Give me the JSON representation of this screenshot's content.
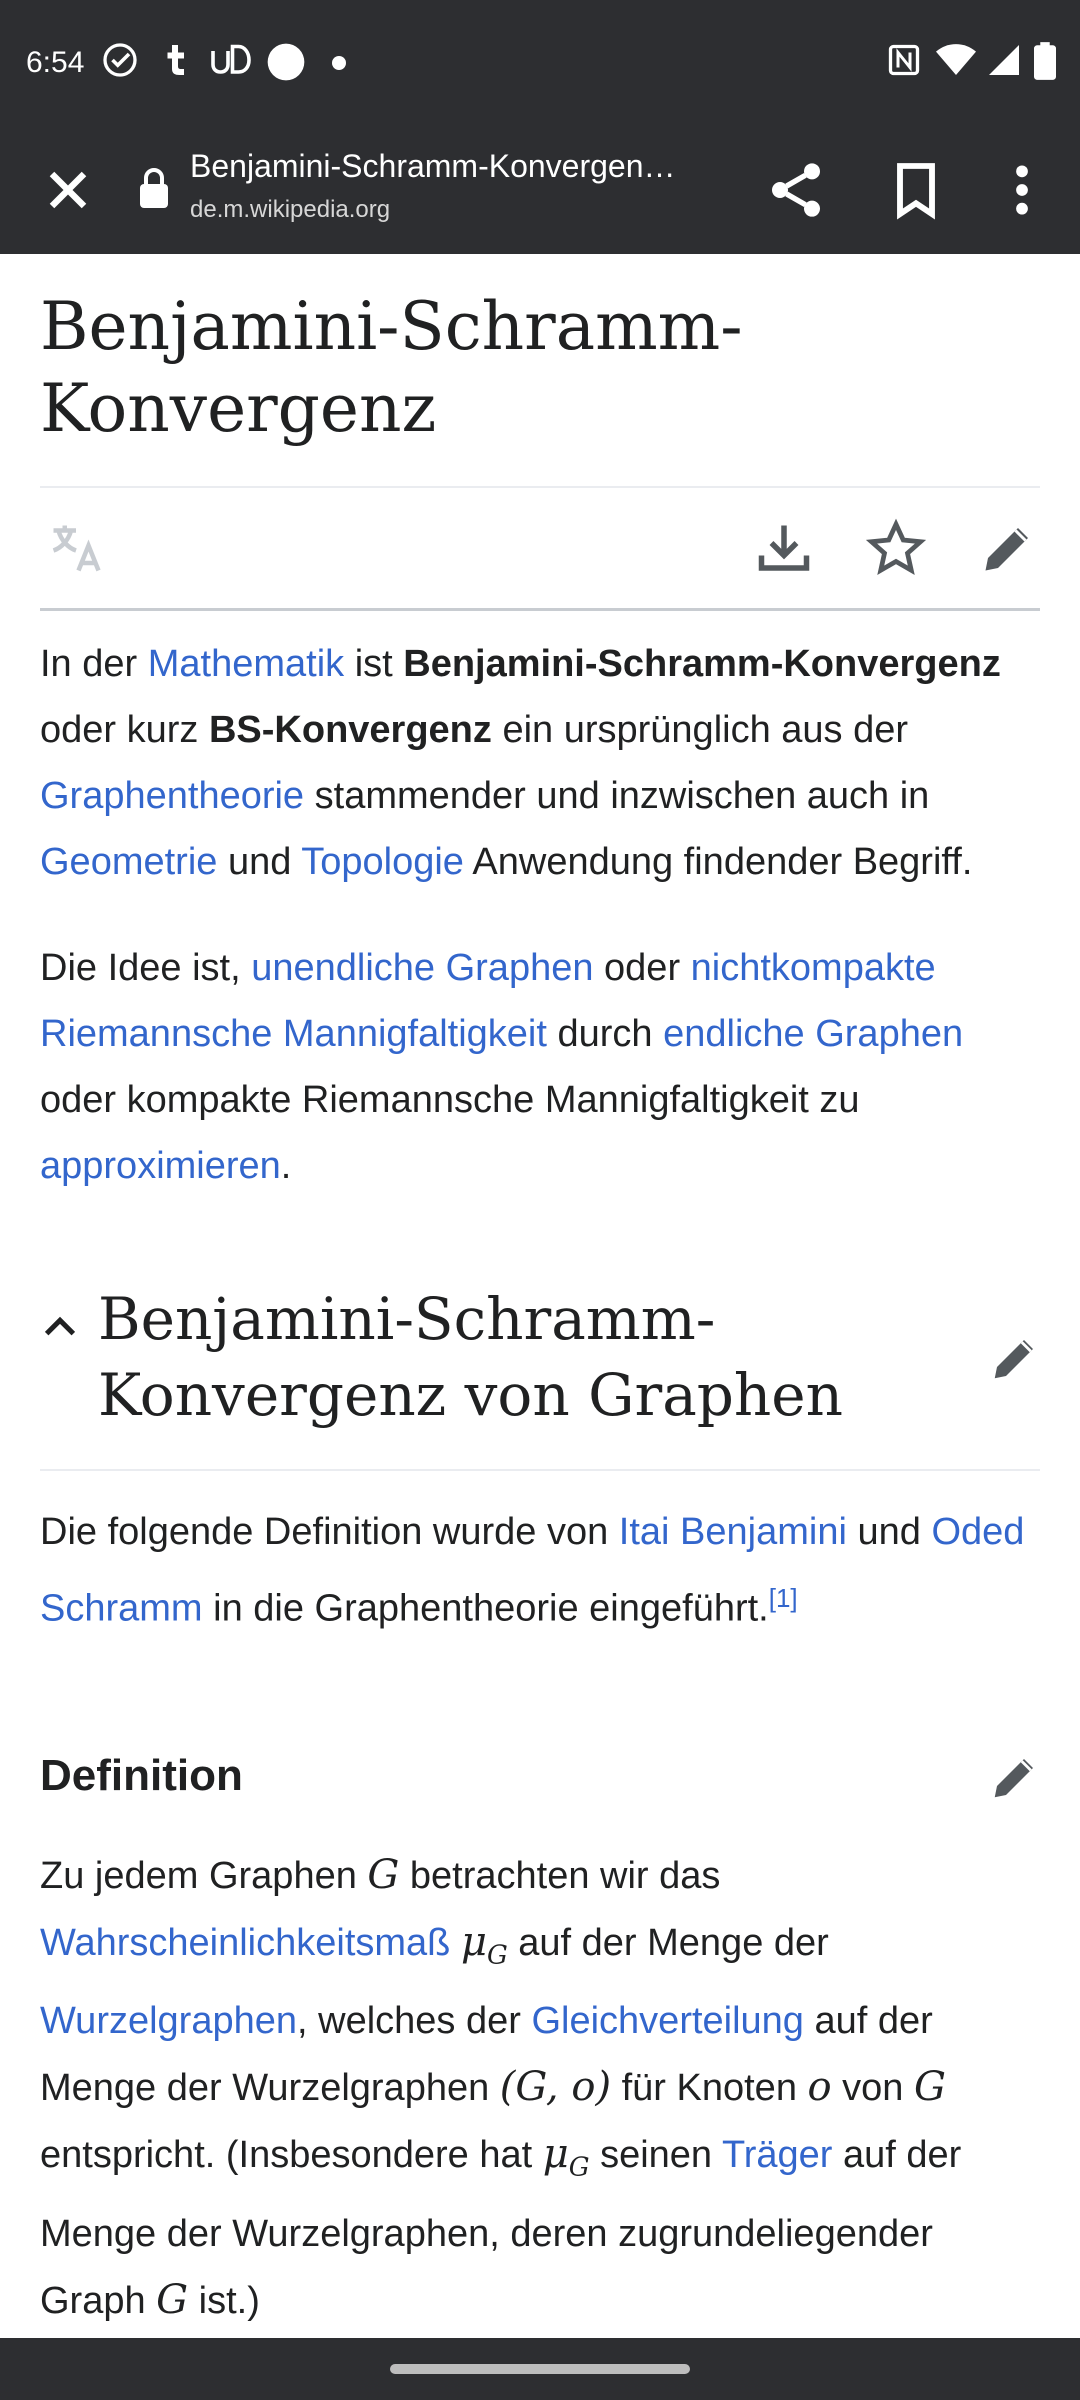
{
  "status_bar": {
    "time": "6:54",
    "left_icons": [
      "check-circle-icon",
      "tumblr-icon",
      "ud-icon",
      "circle-icon",
      "dot-icon"
    ],
    "right_icons": [
      "nfc-icon",
      "wifi-icon",
      "signal-icon",
      "battery-icon"
    ]
  },
  "toolbar": {
    "title": "Benjamini-Schramm-Konvergen…",
    "url": "de.m.wikipedia.org",
    "close_icon": "close-icon",
    "lock_icon": "lock-icon",
    "share_icon": "share-icon",
    "bookmark_icon": "bookmark-icon",
    "more_icon": "more-vert-icon"
  },
  "article": {
    "title_line1": "Benjamini-Schramm-",
    "title_line2": "Konvergenz",
    "actions": [
      "language-icon",
      "download-icon",
      "star-icon",
      "edit-icon"
    ],
    "p1": {
      "t1": "In der ",
      "l1": "Mathematik",
      "t2": " ist ",
      "b1": "Benjamini-Schramm-Konvergenz",
      "t3": " oder kurz ",
      "b2": "BS-Konvergenz",
      "t4": " ein ursprünglich aus der ",
      "l2": "Graphentheorie",
      "t5": " stammender und inzwischen auch in ",
      "l3": "Geometrie",
      "t6": " und ",
      "l4": "Topologie",
      "t7": " Anwendung findender Begriff."
    },
    "p2": {
      "t1": "Die Idee ist, ",
      "l1": "unendliche Graphen",
      "t2": " oder ",
      "l2": "nichtkompakte Riemannsche Mannigfaltigkeit",
      "t3": " durch ",
      "l3": "endliche Graphen",
      "t4": " oder kompakte Riemannsche Mannigfaltigkeit zu ",
      "l4": "approximieren",
      "t5": "."
    },
    "section1": {
      "title_line1": "Benjamini-Schramm-",
      "title_line2": "Konvergenz von Graphen",
      "p": {
        "t1": "Die folgende Definition wurde von ",
        "l1": "Itai Benjamini",
        "t2": " und ",
        "l2": "Oded Schramm",
        "t3": " in die Graphentheorie eingeführt.",
        "ref": "[1]"
      }
    },
    "section2": {
      "title": "Definition",
      "p": {
        "t1": "Zu jedem Graphen ",
        "m1": "G",
        "t2": " betrachten wir das ",
        "l1": "Wahrscheinlichkeitsmaß",
        "m2": "μ",
        "m2sub": "G",
        "t3": " auf der Menge der ",
        "l2": "Wurzelgraphen",
        "t4": ", welches der ",
        "l3": "Gleichverteilung",
        "t5": " auf der Menge der Wurzelgraphen ",
        "m3": "(G, o)",
        "t6": " für Knoten ",
        "m4": "o",
        "t7": " von ",
        "m5": "G",
        "t8": " entspricht. (Insbesondere hat ",
        "m6": "μ",
        "m6sub": "G",
        "t9": " seinen ",
        "l4": "Träger",
        "t10": " auf der Menge der Wurzelgraphen, deren zugrundeliegender Graph ",
        "m7": "G",
        "t11": " ist.)"
      }
    }
  },
  "colors": {
    "bar_bg": "#2d2e31",
    "link": "#3366cc",
    "text": "#202122"
  }
}
